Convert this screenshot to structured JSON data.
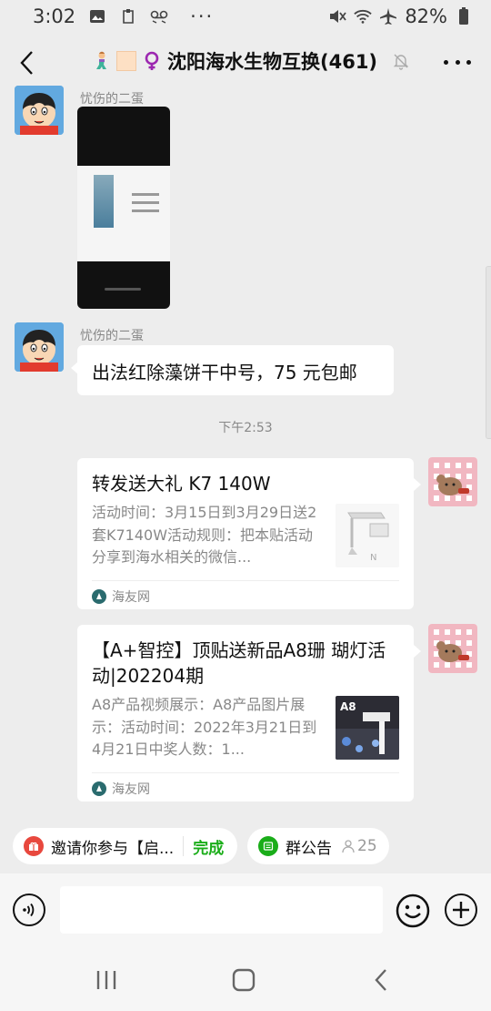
{
  "status_bar": {
    "time": "3:02",
    "left_icons": [
      "image-icon",
      "clipboard-icon",
      "voicemail-icon"
    ],
    "overflow": "···",
    "battery": "82%",
    "right_icons": [
      "mute-icon",
      "wifi-icon",
      "airplane-icon",
      "battery-icon"
    ]
  },
  "header": {
    "title": "沈阳海水生物互换(461)",
    "title_prefix_icons": [
      "mermaid-icon",
      "peach-square-icon",
      "female-sign-icon"
    ],
    "back_icon": "chevron-left-icon",
    "muted_icon": "bell-off-icon",
    "more_icon": "more-dots-icon"
  },
  "messages": {
    "msg1": {
      "sender": "忧伤的二蛋",
      "type": "image"
    },
    "msg2": {
      "sender": "忧伤的二蛋",
      "text": "出法红除藻饼干中号，75 元包邮"
    },
    "time_divider": "下午2:53",
    "card1": {
      "title": "转发送大礼  K7 140W",
      "desc": "活动时间：3月15日到3月29日送2套K7140W活动规则：把本贴活动分享到海水相关的微信...",
      "source": "海友网"
    },
    "card2": {
      "title": "【A+智控】顶贴送新品A8珊 瑚灯活动|202204期",
      "desc": "A8产品视频展示：A8产品图片展示：活动时间：2022年3月21日到4月21日中奖人数：1...",
      "thumb_label": "A8",
      "source": "海友网"
    }
  },
  "quick_bar": {
    "invite_text": "邀请你参与【启...",
    "invite_done": "完成",
    "notice_text": "群公告",
    "notice_count": "25"
  },
  "colors": {
    "background": "#ededed",
    "accent_green": "#1aad19",
    "invite_red": "#e8483e"
  }
}
